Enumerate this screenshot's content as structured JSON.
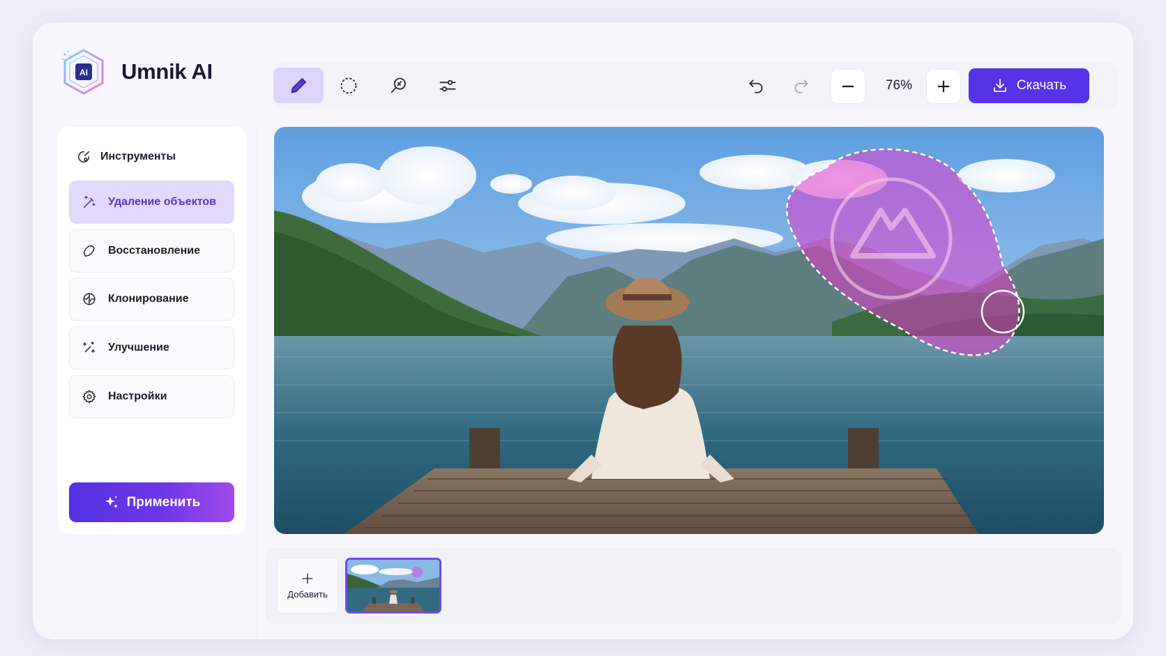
{
  "app": {
    "name": "Umnik AI",
    "logo_badge": "AI"
  },
  "toolbar": {
    "tools": [
      {
        "name": "brush",
        "icon": "pencil-icon",
        "active": true
      },
      {
        "name": "lasso",
        "icon": "dashed-circle-icon",
        "active": false
      },
      {
        "name": "healing",
        "icon": "magnifier-brush-icon",
        "active": false
      },
      {
        "name": "adjust",
        "icon": "sliders-icon",
        "active": false
      }
    ],
    "undo_icon": "undo-icon",
    "redo_icon": "redo-icon",
    "zoom": "76%",
    "download_label": "Скачать"
  },
  "sidebar": {
    "header": "Инструменты",
    "items": [
      {
        "label": "Удаление объектов",
        "icon": "magic-wand-icon",
        "active": true
      },
      {
        "label": "Восстановление",
        "icon": "bandage-icon",
        "active": false
      },
      {
        "label": "Клонирование",
        "icon": "clone-icon",
        "active": false
      },
      {
        "label": "Улучшение",
        "icon": "sparkle-enhance-icon",
        "active": false
      },
      {
        "label": "Настройки",
        "icon": "gear-icon",
        "active": false
      }
    ],
    "apply_label": "Применить"
  },
  "filmstrip": {
    "add_label": "Добавить"
  },
  "colors": {
    "accent": "#5533e6",
    "active_bg": "#e2dafd",
    "selection_mask": "#e03dc8"
  }
}
